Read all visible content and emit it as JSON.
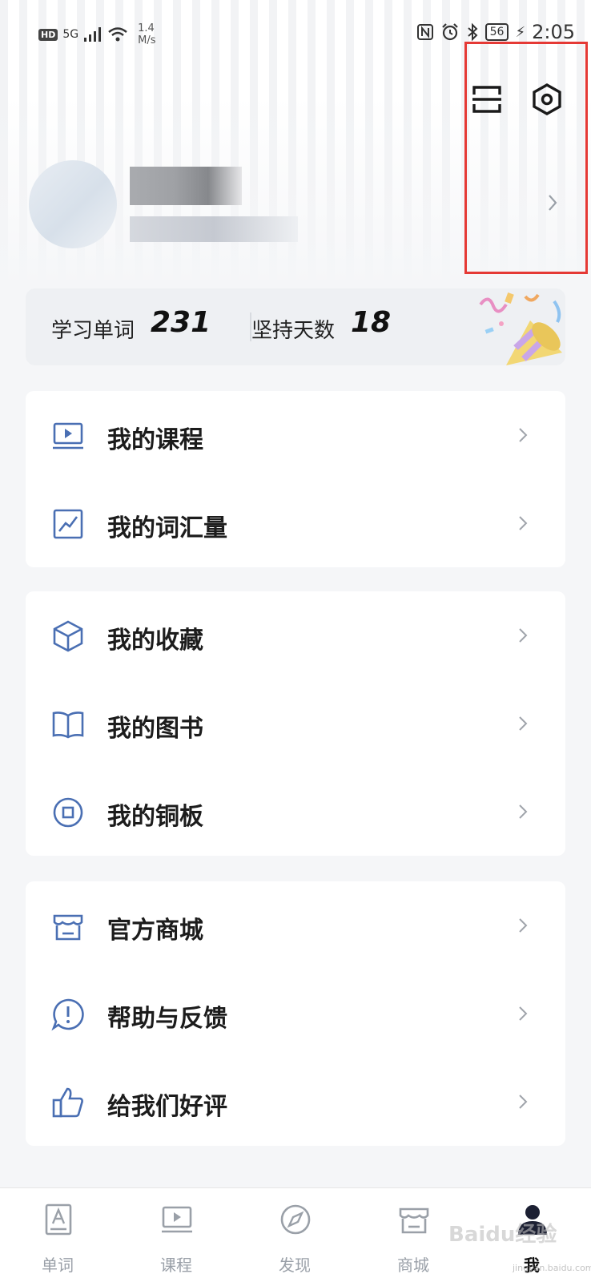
{
  "status_bar": {
    "hd": "HD",
    "network": "5G",
    "speed_value": "1.4",
    "speed_unit": "M/s",
    "battery": "56",
    "time": "2:05"
  },
  "stats": {
    "words_label": "学习单词",
    "words_value": "231",
    "days_label": "坚持天数",
    "days_value": "18"
  },
  "menu_groups": [
    {
      "items": [
        {
          "label": "我的课程",
          "icon": "video-lesson-icon"
        },
        {
          "label": "我的词汇量",
          "icon": "chart-trend-icon"
        }
      ]
    },
    {
      "items": [
        {
          "label": "我的收藏",
          "icon": "cube-icon"
        },
        {
          "label": "我的图书",
          "icon": "book-icon"
        },
        {
          "label": "我的铜板",
          "icon": "coin-icon"
        }
      ]
    },
    {
      "items": [
        {
          "label": "官方商城",
          "icon": "store-icon"
        },
        {
          "label": "帮助与反馈",
          "icon": "help-feedback-icon"
        },
        {
          "label": "给我们好评",
          "icon": "thumbs-up-icon"
        }
      ]
    }
  ],
  "bottom_nav": [
    {
      "label": "单词",
      "icon": "word-card-icon",
      "active": false
    },
    {
      "label": "课程",
      "icon": "video-lesson-icon",
      "active": false
    },
    {
      "label": "发现",
      "icon": "compass-icon",
      "active": false
    },
    {
      "label": "商城",
      "icon": "store-icon",
      "active": false
    },
    {
      "label": "我",
      "icon": "user-icon",
      "active": true
    }
  ],
  "watermark": {
    "text": "Baidu经验",
    "sub": "jingyan.baidu.com"
  },
  "colors": {
    "icon_blue": "#4a6fb3",
    "highlight_red": "#e53935",
    "nav_inactive": "#9aa0a8"
  }
}
